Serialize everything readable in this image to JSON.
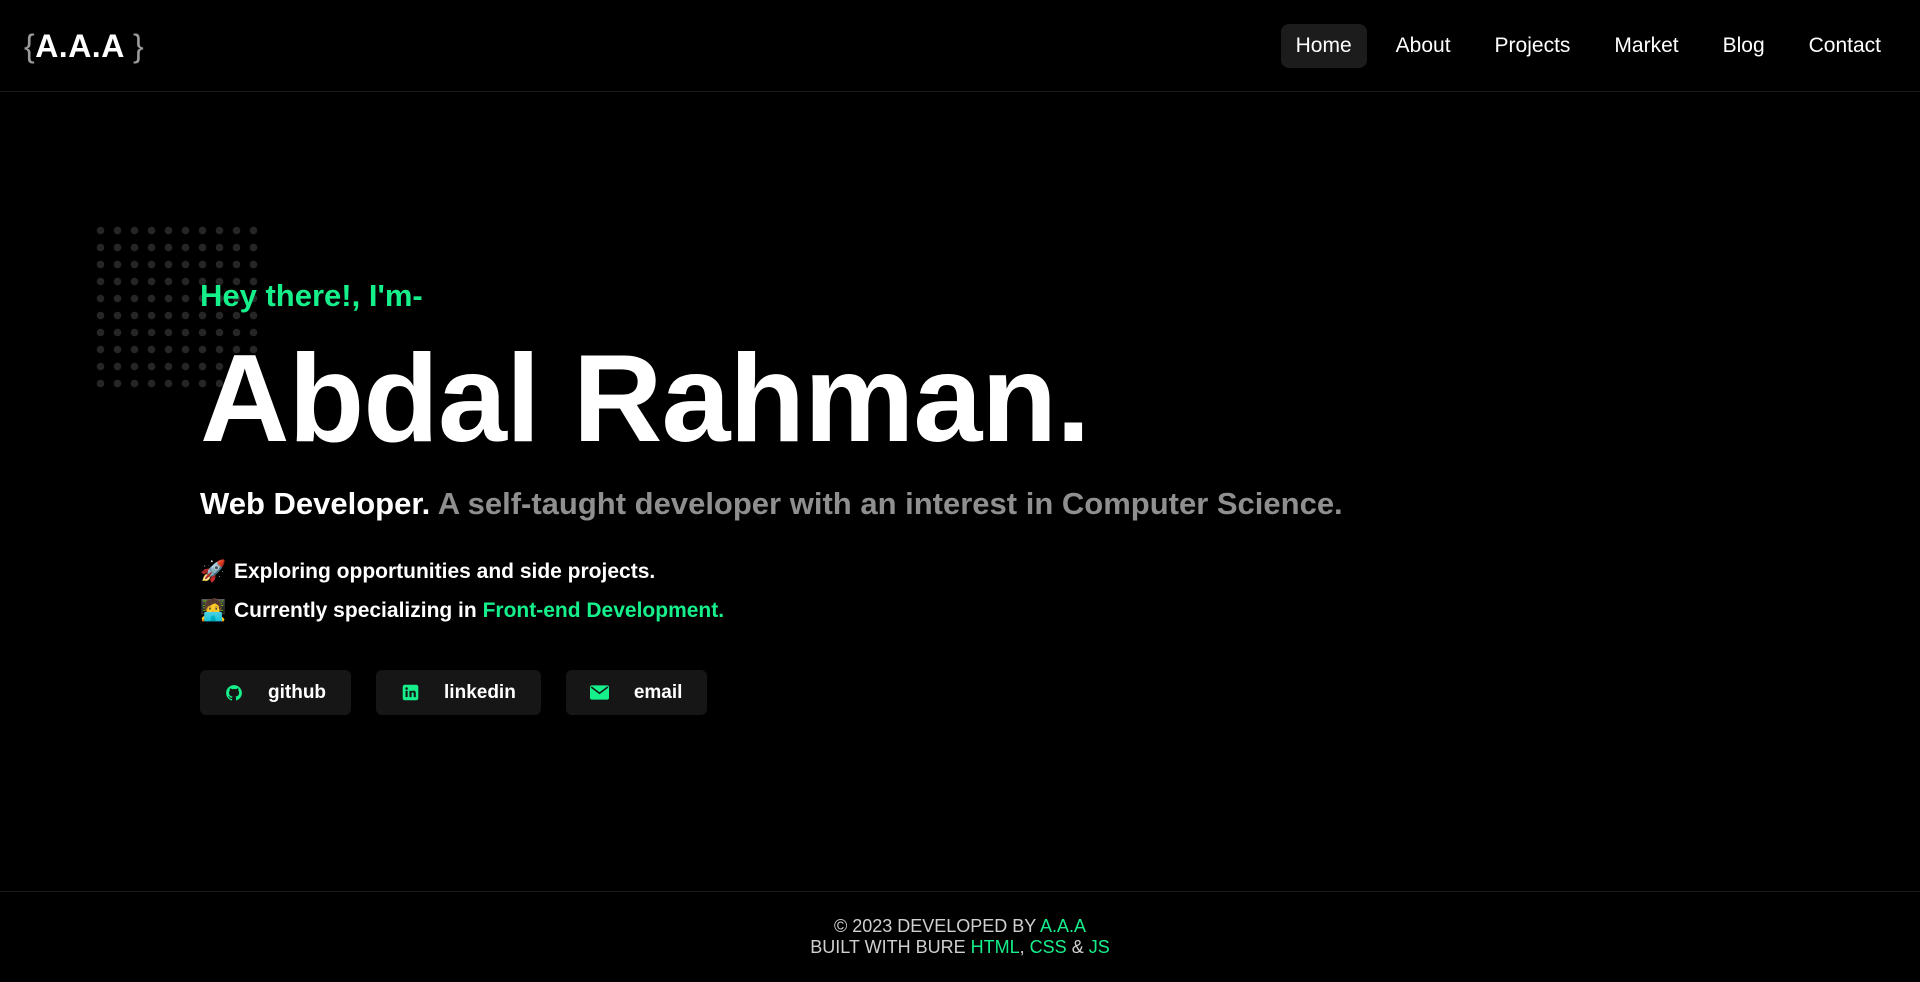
{
  "header": {
    "logo": {
      "open_brace": "{",
      "text": "A.A.A",
      "close_brace": "}"
    },
    "nav": [
      {
        "label": "Home",
        "active": true
      },
      {
        "label": "About",
        "active": false
      },
      {
        "label": "Projects",
        "active": false
      },
      {
        "label": "Market",
        "active": false
      },
      {
        "label": "Blog",
        "active": false
      },
      {
        "label": "Contact",
        "active": false
      }
    ]
  },
  "hero": {
    "greeting": "Hey there!, I'm-",
    "name": "Abdal Rahman.",
    "role": "Web Developer.",
    "tagline": "A self-taught developer with an interest in Computer Science.",
    "bullets": [
      {
        "emoji": "🚀",
        "text": "Exploring opportunities and side projects.",
        "accent": ""
      },
      {
        "emoji": "🧑‍💻",
        "text": "Currently specializing in ",
        "accent": "Front-end Development."
      }
    ],
    "socials": [
      {
        "label": "github",
        "icon": "github-icon"
      },
      {
        "label": "linkedin",
        "icon": "linkedin-icon"
      },
      {
        "label": "email",
        "icon": "mail-icon"
      }
    ]
  },
  "footer": {
    "line1_prefix": "© 2023 DEVELOPED BY",
    "line1_brand": "A.A.A",
    "line2_prefix": "BUILT WITH BURE",
    "html": "HTML",
    "comma": ",",
    "css": "CSS",
    "amp": "&",
    "js": "JS"
  },
  "colors": {
    "background": "#000000",
    "accent": "#16f08b",
    "muted_text": "#8f8f8f",
    "card_bg": "#161616"
  }
}
